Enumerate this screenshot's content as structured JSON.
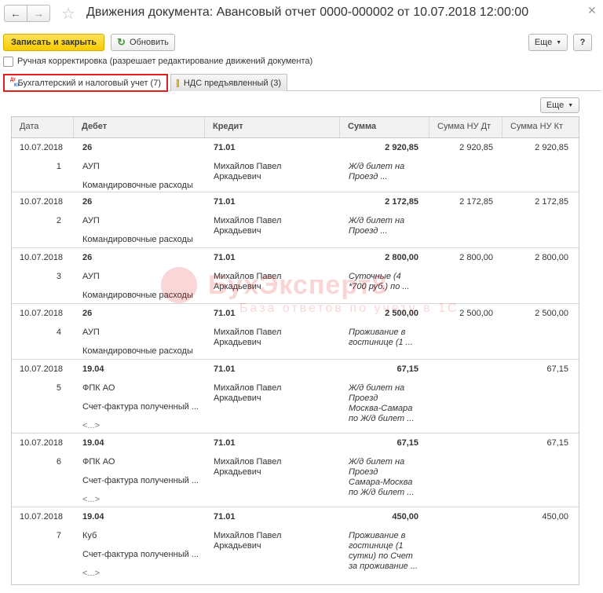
{
  "header": {
    "title": "Движения документа: Авансовый отчет 0000-000002 от 10.07.2018 12:00:00"
  },
  "toolbar": {
    "save_close": "Записать и закрыть",
    "refresh": "Обновить",
    "more": "Еще",
    "help": "?"
  },
  "manual_correction": {
    "label": "Ручная корректировка (разрешает редактирование движений документа)",
    "checked": false
  },
  "tabs": [
    {
      "label": "Бухгалтерский и налоговый учет (7)",
      "icon": "dt-kt-icon",
      "active": true
    },
    {
      "label": "НДС предъявленный (3)",
      "icon": "vat-register-icon",
      "active": false
    }
  ],
  "grid": {
    "more": "Еще",
    "columns": [
      "Дата",
      "Дебет",
      "Кредит",
      "Сумма",
      "Сумма НУ Дт",
      "Сумма НУ Кт"
    ],
    "rows": [
      {
        "date": "10.07.2018",
        "num": "1",
        "debit": "26",
        "debit_sub1": "АУП",
        "debit_sub2": "Командировочные расходы",
        "credit": "71.01",
        "credit_sub": "Михайлов Павел\nАркадьевич",
        "sum": "2 920,85",
        "content": "Ж/д билет на\nПроезд ...",
        "nu_dt": "2 920,85",
        "nu_kt": "2 920,85"
      },
      {
        "date": "10.07.2018",
        "num": "2",
        "debit": "26",
        "debit_sub1": "АУП",
        "debit_sub2": "Командировочные расходы",
        "credit": "71.01",
        "credit_sub": "Михайлов Павел\nАркадьевич",
        "sum": "2 172,85",
        "content": "Ж/д билет на\nПроезд ...",
        "nu_dt": "2 172,85",
        "nu_kt": "2 172,85"
      },
      {
        "date": "10.07.2018",
        "num": "3",
        "debit": "26",
        "debit_sub1": "АУП",
        "debit_sub2": "Командировочные расходы",
        "credit": "71.01",
        "credit_sub": "Михайлов Павел\nАркадьевич",
        "sum": "2 800,00",
        "content": "Суточные (4\n*700 руб.) по ...",
        "nu_dt": "2 800,00",
        "nu_kt": "2 800,00"
      },
      {
        "date": "10.07.2018",
        "num": "4",
        "debit": "26",
        "debit_sub1": "АУП",
        "debit_sub2": "Командировочные расходы",
        "credit": "71.01",
        "credit_sub": "Михайлов Павел\nАркадьевич",
        "sum": "2 500,00",
        "content": "Проживание в\nгостинице (1 ...",
        "nu_dt": "2 500,00",
        "nu_kt": "2 500,00"
      },
      {
        "date": "10.07.2018",
        "num": "5",
        "debit": "19.04",
        "debit_sub1": "ФПК АО",
        "debit_sub2": "Счет-фактура полученный ...",
        "debit_sub3": "<...>",
        "credit": "71.01",
        "credit_sub": "Михайлов Павел\nАркадьевич",
        "sum": "67,15",
        "content": "Ж/д билет на\nПроезд\nМосква-Самара\nпо Ж/д билет ...",
        "nu_dt": "",
        "nu_kt": "67,15"
      },
      {
        "date": "10.07.2018",
        "num": "6",
        "debit": "19.04",
        "debit_sub1": "ФПК АО",
        "debit_sub2": "Счет-фактура полученный ...",
        "debit_sub3": "<...>",
        "credit": "71.01",
        "credit_sub": "Михайлов Павел\nАркадьевич",
        "sum": "67,15",
        "content": "Ж/д билет на\nПроезд\nСамара-Москва\nпо Ж/д билет ...",
        "nu_dt": "",
        "nu_kt": "67,15"
      },
      {
        "date": "10.07.2018",
        "num": "7",
        "debit": "19.04",
        "debit_sub1": "Куб",
        "debit_sub2": "Счет-фактура полученный ...",
        "debit_sub3": "<...>",
        "credit": "71.01",
        "credit_sub": "Михайлов Павел\nАркадьевич",
        "sum": "450,00",
        "content": "Проживание в\nгостинице (1\nсутки) по Счет\nза проживание ...",
        "nu_dt": "",
        "nu_kt": "450,00"
      }
    ]
  },
  "watermark": {
    "text": "БухЭксперт8",
    "sub": "База ответов по учету в 1С"
  },
  "colors": {
    "save_button": "#f8cb00",
    "active_tab_outline": "#e02020",
    "header_bg": "#f2f2f2"
  }
}
